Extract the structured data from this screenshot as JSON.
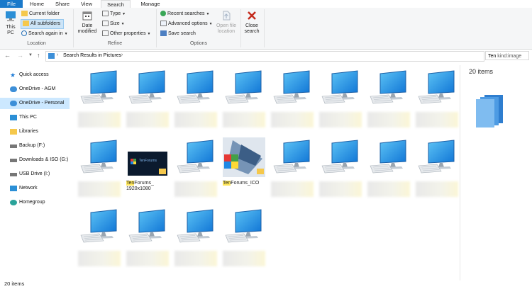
{
  "window": {
    "tabs": [
      "File",
      "Home",
      "Share",
      "View",
      "Search",
      "Manage"
    ]
  },
  "ribbon": {
    "location": {
      "this_pc": "This PC",
      "current_folder": "Current folder",
      "all_subfolders": "All subfolders",
      "search_again_in": "Search again in",
      "label": "Location"
    },
    "refine": {
      "date_modified": "Date modified",
      "type": "Type",
      "size": "Size",
      "other_properties": "Other properties",
      "label": "Refine"
    },
    "options": {
      "recent_searches": "Recent searches",
      "advanced_options": "Advanced options",
      "save_search": "Save search",
      "open_file_location": "Open file location",
      "label": "Options"
    },
    "close_search": "Close search"
  },
  "address": {
    "path": "Search Results in Pictures",
    "search_text": "Ten",
    "search_filter": "kind:image"
  },
  "nav_pane": {
    "items": [
      {
        "label": "Quick access",
        "icon": "star-icon"
      },
      {
        "label": "OneDrive - AGM",
        "icon": "onedrive-icon"
      },
      {
        "label": "OneDrive - Personal",
        "icon": "onedrive-icon"
      },
      {
        "label": "This PC",
        "icon": "computer-icon"
      },
      {
        "label": "Libraries",
        "icon": "libraries-icon"
      },
      {
        "label": "Backup (F:)",
        "icon": "drive-icon"
      },
      {
        "label": "Downloads & ISO (G:)",
        "icon": "drive-icon"
      },
      {
        "label": "USB Drive (I:)",
        "icon": "usb-drive-icon"
      },
      {
        "label": "Network",
        "icon": "network-icon"
      },
      {
        "label": "Homegroup",
        "icon": "homegroup-icon"
      }
    ]
  },
  "files": {
    "tenforums_1920": {
      "highlight": "Ten",
      "rest_line1": "Forums_",
      "line2": "1920x1080",
      "thumb_text": "TenForums"
    },
    "tenforums_ico": {
      "highlight": "Ten",
      "rest": "Forums_ICO"
    }
  },
  "details": {
    "count": "20 items"
  },
  "status": {
    "count": "20 items"
  }
}
